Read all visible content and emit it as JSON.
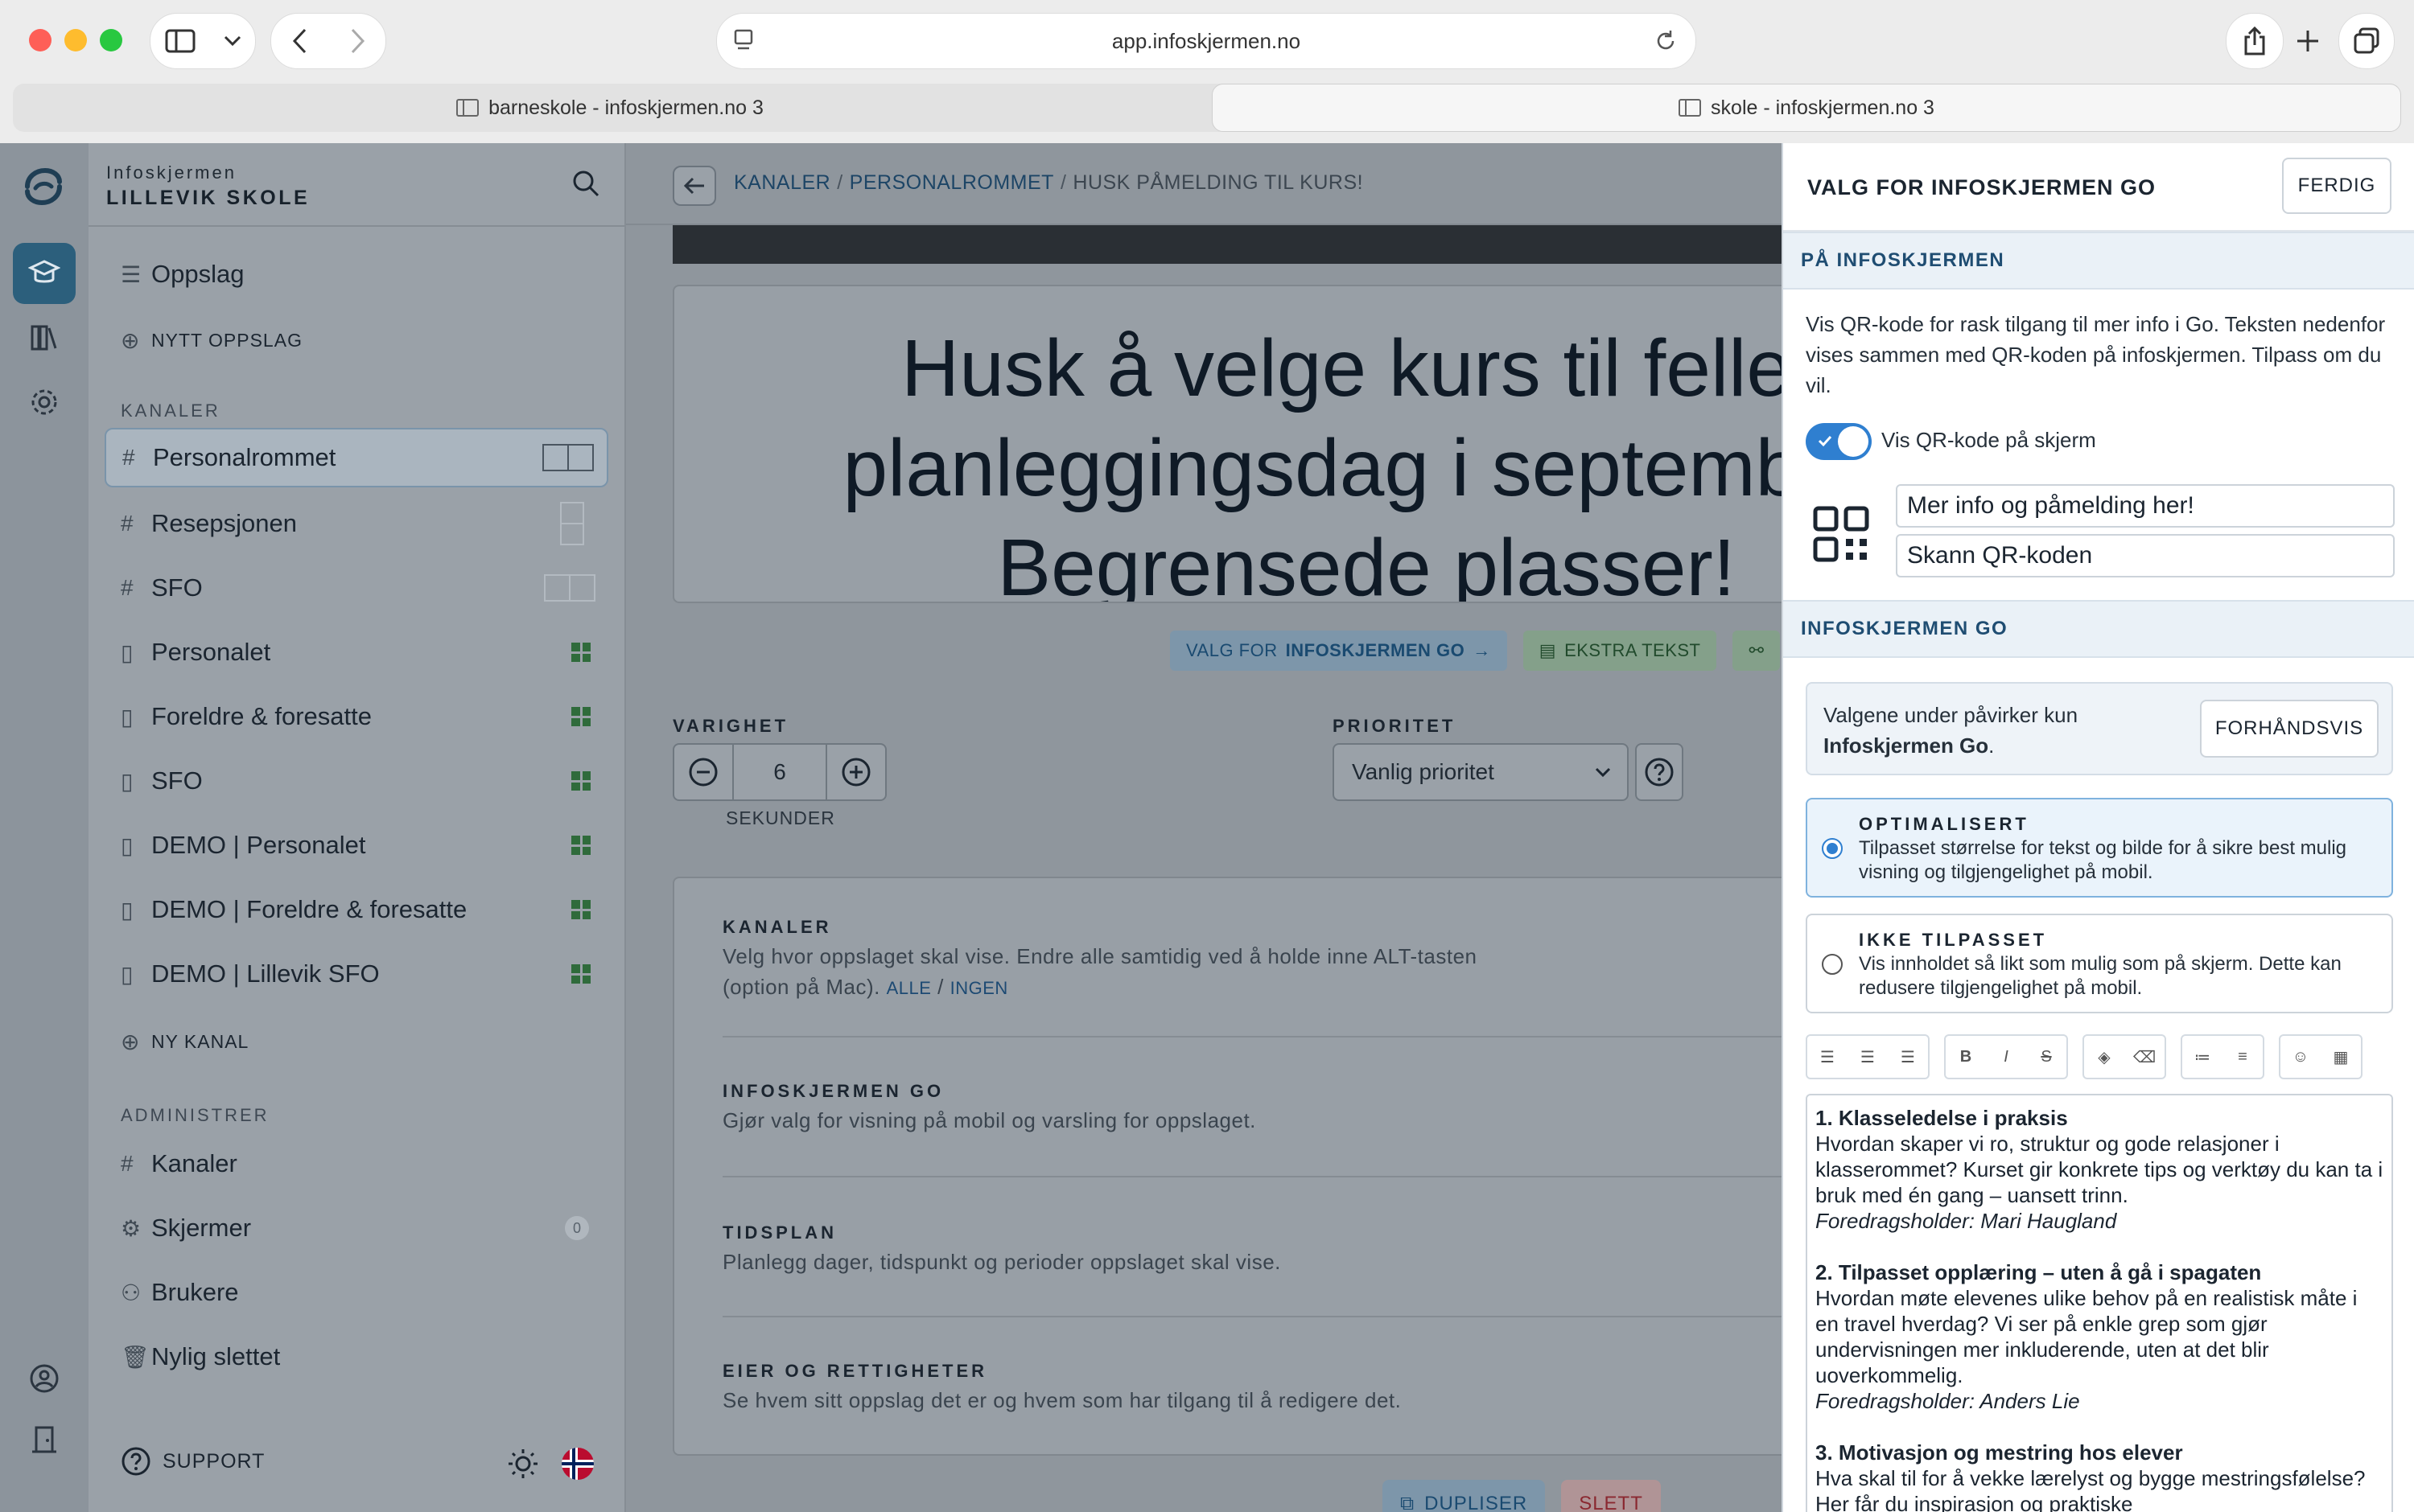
{
  "browser": {
    "url": "app.infoskjermen.no",
    "tabs": [
      {
        "label": "barneskole - infoskjermen.no 3"
      },
      {
        "label": "skole - infoskjermen.no 3"
      }
    ]
  },
  "brand": {
    "kicker": "Infoskjermen",
    "school": "LILLEVIK SKOLE"
  },
  "sidebar": {
    "oppslag": "Oppslag",
    "new_post": "NYTT OPPSLAG",
    "channels_heading": "KANALER",
    "channels": [
      {
        "label": "Personalrommet",
        "glyph": "#",
        "icon": "layout-split-icon"
      },
      {
        "label": "Resepsjonen",
        "glyph": "#",
        "icon": "layout-vertical-icon"
      },
      {
        "label": "SFO",
        "glyph": "#",
        "icon": "layout-split-icon"
      },
      {
        "label": "Personalet",
        "glyph": "phone",
        "icon": "qr-grid-icon"
      },
      {
        "label": "Foreldre & foresatte",
        "glyph": "phone",
        "icon": "qr-grid-icon"
      },
      {
        "label": "SFO",
        "glyph": "phone",
        "icon": "qr-grid-icon"
      },
      {
        "label": "DEMO | Personalet",
        "glyph": "phone",
        "icon": "qr-grid-icon"
      },
      {
        "label": "DEMO | Foreldre & foresatte",
        "glyph": "phone",
        "icon": "qr-grid-icon"
      },
      {
        "label": "DEMO | Lillevik SFO",
        "glyph": "phone",
        "icon": "qr-grid-icon"
      }
    ],
    "new_channel": "NY KANAL",
    "admin_heading": "ADMINISTRER",
    "admin": [
      {
        "label": "Kanaler"
      },
      {
        "label": "Skjermer",
        "badge": "0"
      },
      {
        "label": "Brukere"
      },
      {
        "label": "Nylig slettet"
      }
    ],
    "support": "SUPPORT"
  },
  "main": {
    "breadcrumb": [
      "KANALER",
      "PERSONALROMMET",
      "HUSK PÅMELDING TIL KURS!"
    ],
    "headline": "Husk å velge kurs til felles planleggingsdag i september. Begrensede plasser!",
    "chips": [
      {
        "pre": "VALG FOR ",
        "bold": "INFOSKJERMEN GO",
        "post": " →"
      },
      {
        "label": "EKSTRA TEKST"
      }
    ],
    "duration_label": "VARIGHET",
    "duration_value": "6",
    "duration_unit": "SEKUNDER",
    "priority_label": "PRIORITET",
    "priority_value": "Vanlig prioritet",
    "settings": [
      {
        "title": "KANALER",
        "desc": "Velg hvor oppslaget skal vise. Endre alle samtidig ved å holde inne ALT-tasten (option på Mac).",
        "link_all": "ALLE",
        "link_none": "INGEN"
      },
      {
        "title": "INFOSKJERMEN GO",
        "desc": "Gjør valg for visning på mobil og varsling for oppslaget."
      },
      {
        "title": "TIDSPLAN",
        "desc": "Planlegg dager, tidspunkt og perioder oppslaget skal vise."
      },
      {
        "title": "EIER OG RETTIGHETER",
        "desc": "Se hvem sitt oppslag det er og hvem som har tilgang til å redigere det."
      }
    ],
    "duplicate": "DUPLISER",
    "delete": "SLETT"
  },
  "drawer": {
    "title": "VALG FOR INFOSKJERMEN GO",
    "done": "FERDIG",
    "section1": "PÅ INFOSKJERMEN",
    "para": "Vis QR-kode for rask tilgang til mer info i Go. Teksten nedenfor vises sammen med QR-koden på infoskjermen. Tilpass om du vil.",
    "toggle_label": "Vis QR-kode på skjerm",
    "qr_line1": "Mer info og påmelding her!",
    "qr_line2": "Skann QR-koden",
    "section2": "INFOSKJERMEN GO",
    "info_line1": "Valgene under påvirker kun",
    "info_line2": "Infoskjermen Go",
    "info_dot": ".",
    "preview": "FORHÅNDSVIS",
    "opt1_title": "OPTIMALISERT",
    "opt1_desc": "Tilpasset størrelse for tekst og bilde for å sikre best mulig visning og tilgjengelighet på mobil.",
    "opt2_title": "IKKE TILPASSET",
    "opt2_desc": "Vis innholdet så likt som mulig som på skjerm. Dette kan redusere tilgjengelighet på mobil.",
    "editor": [
      {
        "h": "1. Klasseledelse i praksis",
        "p": "Hvordan skaper vi ro, struktur og gode relasjoner i klasserommet? Kurset gir konkrete tips og verktøy du kan ta i bruk med én gang – uansett trinn.",
        "a": "Foredragsholder: Mari Haugland"
      },
      {
        "h": "2. Tilpasset opplæring – uten å gå i spagaten",
        "p": "Hvordan møte elevenes ulike behov på en realistisk måte i en travel hverdag? Vi ser på enkle grep som gjør undervisningen mer inkluderende, uten at det blir uoverkommelig.",
        "a": "Foredragsholder: Anders Lie"
      },
      {
        "h": "3. Motivasjon og mestring hos elever",
        "p": "Hva skal til for å vekke lærelyst og bygge mestringsfølelse? Her får du inspirasjon og praktiske",
        "a": ""
      }
    ]
  },
  "colors": {
    "accent": "#2f7fd0",
    "brand_dark": "#2c5f7c",
    "heading_blue": "#1f4d72"
  }
}
